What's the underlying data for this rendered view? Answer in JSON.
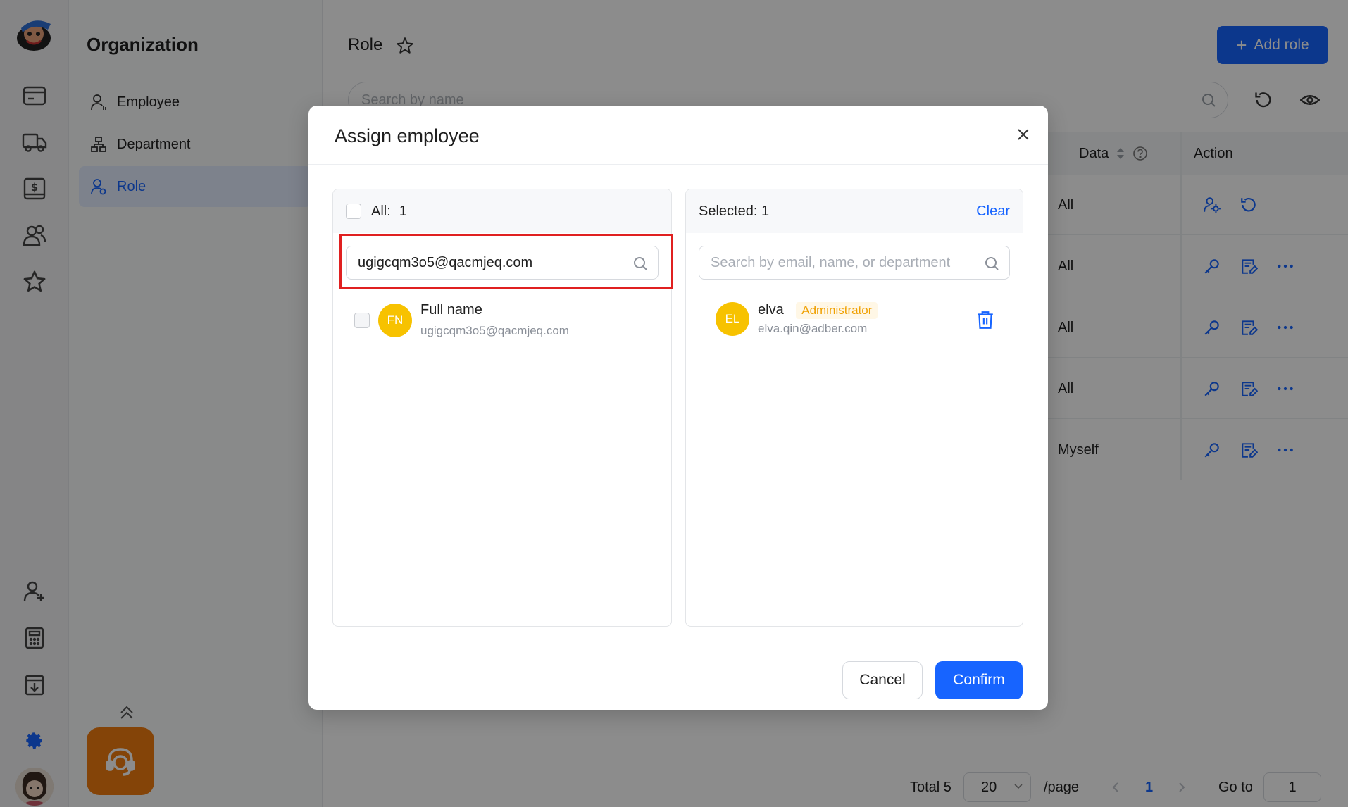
{
  "app": {
    "org_title": "Organization",
    "nav": [
      {
        "label": "Employee"
      },
      {
        "label": "Department"
      },
      {
        "label": "Role"
      }
    ],
    "rail_icons": [
      "wallet-icon",
      "truck-icon",
      "dollar-receipt-icon",
      "users-icon",
      "star-icon",
      "add-user-icon",
      "calculator-icon",
      "download-doc-icon",
      "gear-icon"
    ]
  },
  "main": {
    "title": "Role",
    "add_role_label": "Add role",
    "search_placeholder": "Search by name",
    "columns": {
      "data": "Data",
      "action": "Action"
    },
    "rows": [
      {
        "data": "All"
      },
      {
        "data": "All"
      },
      {
        "data": "All"
      },
      {
        "data": "All"
      },
      {
        "data": "Myself"
      }
    ],
    "pagination": {
      "total_label": "Total 5",
      "page_size": "20",
      "per_page_label": "/page",
      "current_page": "1",
      "goto_label": "Go to",
      "goto_value": "1"
    }
  },
  "modal": {
    "title": "Assign employee",
    "left": {
      "all_label": "All:",
      "all_count": "1",
      "search_value": "ugigcqm3o5@qacmjeq.com",
      "results": [
        {
          "initials": "FN",
          "name": "Full name",
          "email": "ugigcqm3o5@qacmjeq.com"
        }
      ]
    },
    "right": {
      "selected_label": "Selected: 1",
      "clear_label": "Clear",
      "search_placeholder": "Search by email, name, or department",
      "selected": [
        {
          "initials": "EL",
          "name": "elva",
          "tag": "Administrator",
          "email": "elva.qin@adber.com"
        }
      ]
    },
    "cancel_label": "Cancel",
    "confirm_label": "Confirm"
  },
  "colors": {
    "primary": "#1764ff",
    "avatar_yellow": "#f7c200",
    "highlight_red": "#e02020",
    "support_orange": "#f07c10",
    "tag_orange": "#f0a000"
  }
}
